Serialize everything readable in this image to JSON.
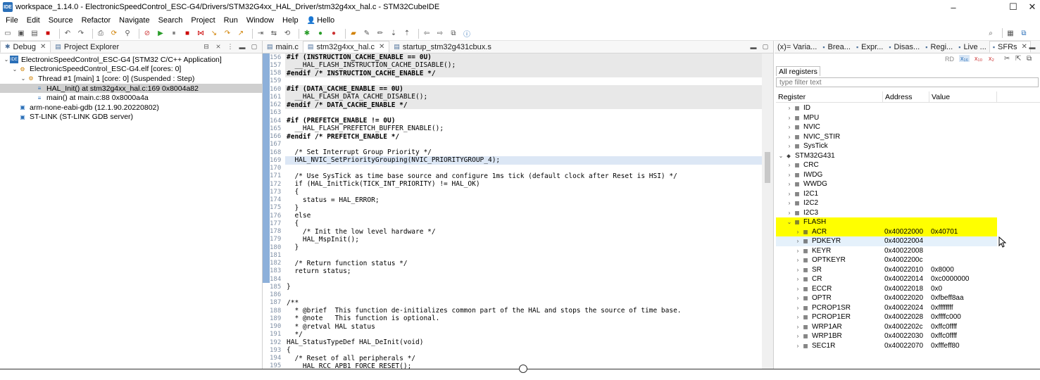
{
  "window": {
    "title": "workspace_1.14.0 - ElectronicSpeedControl_ESC-G4/Drivers/STM32G4xx_HAL_Driver/stm32g4xx_hal.c - STM32CubeIDE",
    "app_icon_label": "IDE"
  },
  "menu": [
    "File",
    "Edit",
    "Source",
    "Refactor",
    "Navigate",
    "Search",
    "Project",
    "Run",
    "Window",
    "Help"
  ],
  "user_label": "Hello",
  "debug_panel": {
    "tabs": [
      {
        "label": "Debug"
      },
      {
        "label": "Project Explorer"
      }
    ],
    "tree": [
      {
        "label": "ElectronicSpeedControl_ESC-G4 [STM32 C/C++ Application]",
        "indent": 0,
        "expanded": true,
        "selected": false
      },
      {
        "label": "ElectronicSpeedControl_ESC-G4.elf [cores: 0]",
        "indent": 1,
        "expanded": true,
        "selected": false
      },
      {
        "label": "Thread #1 [main] 1 [core: 0] (Suspended : Step)",
        "indent": 2,
        "expanded": true,
        "selected": false
      },
      {
        "label": "HAL_Init() at stm32g4xx_hal.c:169 0x8004a82",
        "indent": 3,
        "expanded": null,
        "selected": true
      },
      {
        "label": "main() at main.c:88 0x8000a4a",
        "indent": 3,
        "expanded": null,
        "selected": false
      },
      {
        "label": "arm-none-eabi-gdb (12.1.90.20220802)",
        "indent": 1,
        "expanded": null,
        "selected": false
      },
      {
        "label": "ST-LINK (ST-LINK GDB server)",
        "indent": 1,
        "expanded": null,
        "selected": false
      }
    ]
  },
  "editor": {
    "tabs": [
      {
        "label": "main.c",
        "active": false
      },
      {
        "label": "stm32g4xx_hal.c",
        "active": true
      },
      {
        "label": "startup_stm32g431cbux.s",
        "active": false
      }
    ],
    "lines": [
      {
        "n": "156",
        "text": "#if (INSTRUCTION_CACHE_ENABLE == 0U)",
        "bg": "grey"
      },
      {
        "n": "157",
        "text": "  __HAL_FLASH_INSTRUCTION_CACHE_DISABLE();",
        "bg": "grey"
      },
      {
        "n": "158",
        "text": "#endif /* INSTRUCTION_CACHE_ENABLE */",
        "bg": "grey"
      },
      {
        "n": "159",
        "text": "",
        "bg": ""
      },
      {
        "n": "160",
        "text": "#if (DATA_CACHE_ENABLE == 0U)",
        "bg": "grey"
      },
      {
        "n": "161",
        "text": "  __HAL_FLASH_DATA_CACHE_DISABLE();",
        "bg": "grey"
      },
      {
        "n": "162",
        "text": "#endif /* DATA_CACHE_ENABLE */",
        "bg": "grey"
      },
      {
        "n": "163",
        "text": "",
        "bg": ""
      },
      {
        "n": "164",
        "text": "#if (PREFETCH_ENABLE != 0U)",
        "bg": ""
      },
      {
        "n": "165",
        "text": "  __HAL_FLASH_PREFETCH_BUFFER_ENABLE();",
        "bg": ""
      },
      {
        "n": "166",
        "text": "#endif /* PREFETCH_ENABLE */",
        "bg": ""
      },
      {
        "n": "167",
        "text": "",
        "bg": ""
      },
      {
        "n": "168",
        "text": "  /* Set Interrupt Group Priority */",
        "bg": ""
      },
      {
        "n": "169",
        "text": "  HAL_NVIC_SetPriorityGrouping(NVIC_PRIORITYGROUP_4);",
        "bg": "hl"
      },
      {
        "n": "170",
        "text": "",
        "bg": ""
      },
      {
        "n": "171",
        "text": "  /* Use SysTick as time base source and configure 1ms tick (default clock after Reset is HSI) */",
        "bg": ""
      },
      {
        "n": "172",
        "text": "  if (HAL_InitTick(TICK_INT_PRIORITY) != HAL_OK)",
        "bg": ""
      },
      {
        "n": "173",
        "text": "  {",
        "bg": ""
      },
      {
        "n": "174",
        "text": "    status = HAL_ERROR;",
        "bg": ""
      },
      {
        "n": "175",
        "text": "  }",
        "bg": ""
      },
      {
        "n": "176",
        "text": "  else",
        "bg": ""
      },
      {
        "n": "177",
        "text": "  {",
        "bg": ""
      },
      {
        "n": "178",
        "text": "    /* Init the low level hardware */",
        "bg": ""
      },
      {
        "n": "179",
        "text": "    HAL_MspInit();",
        "bg": ""
      },
      {
        "n": "180",
        "text": "  }",
        "bg": ""
      },
      {
        "n": "181",
        "text": "",
        "bg": ""
      },
      {
        "n": "182",
        "text": "  /* Return function status */",
        "bg": ""
      },
      {
        "n": "183",
        "text": "  return status;",
        "bg": ""
      },
      {
        "n": "184",
        "text": "",
        "bg": ""
      },
      {
        "n": "185",
        "text": "}",
        "bg": ""
      },
      {
        "n": "186",
        "text": "",
        "bg": ""
      },
      {
        "n": "187",
        "text": "/**",
        "bg": ""
      },
      {
        "n": "188",
        "text": "  * @brief  This function de-initializes common part of the HAL and stops the source of time base.",
        "bg": ""
      },
      {
        "n": "189",
        "text": "  * @note   This function is optional.",
        "bg": ""
      },
      {
        "n": "190",
        "text": "  * @retval HAL status",
        "bg": ""
      },
      {
        "n": "191",
        "text": "  */",
        "bg": ""
      },
      {
        "n": "192",
        "text": "HAL_StatusTypeDef HAL_DeInit(void)",
        "bg": ""
      },
      {
        "n": "193",
        "text": "{",
        "bg": ""
      },
      {
        "n": "194",
        "text": "  /* Reset of all peripherals */",
        "bg": ""
      },
      {
        "n": "195",
        "text": "  __HAL_RCC_APB1_FORCE_RESET();",
        "bg": ""
      }
    ]
  },
  "sfr_panel": {
    "tabs": [
      "(x)= Varia...",
      "Brea...",
      "Expr...",
      "Disas...",
      "Regi...",
      "Live ...",
      "SFRs"
    ],
    "rd_label": "RD",
    "all_registers_tab": "All registers",
    "filter_placeholder": "type filter text",
    "columns": [
      "Register",
      "Address",
      "Value"
    ],
    "rows": [
      {
        "name": "ID",
        "indent": 1,
        "exp": ">",
        "address": "",
        "value": "",
        "style": ""
      },
      {
        "name": "MPU",
        "indent": 1,
        "exp": ">",
        "address": "",
        "value": "",
        "style": ""
      },
      {
        "name": "NVIC",
        "indent": 1,
        "exp": ">",
        "address": "",
        "value": "",
        "style": ""
      },
      {
        "name": "NVIC_STIR",
        "indent": 1,
        "exp": ">",
        "address": "",
        "value": "",
        "style": ""
      },
      {
        "name": "SysTick",
        "indent": 1,
        "exp": ">",
        "address": "",
        "value": "",
        "style": ""
      },
      {
        "name": "STM32G431",
        "indent": 0,
        "exp": "v",
        "address": "",
        "value": "",
        "style": ""
      },
      {
        "name": "CRC",
        "indent": 1,
        "exp": ">",
        "address": "",
        "value": "",
        "style": ""
      },
      {
        "name": "IWDG",
        "indent": 1,
        "exp": ">",
        "address": "",
        "value": "",
        "style": ""
      },
      {
        "name": "WWDG",
        "indent": 1,
        "exp": ">",
        "address": "",
        "value": "",
        "style": ""
      },
      {
        "name": "I2C1",
        "indent": 1,
        "exp": ">",
        "address": "",
        "value": "",
        "style": ""
      },
      {
        "name": "I2C2",
        "indent": 1,
        "exp": ">",
        "address": "",
        "value": "",
        "style": ""
      },
      {
        "name": "I2C3",
        "indent": 1,
        "exp": ">",
        "address": "",
        "value": "",
        "style": ""
      },
      {
        "name": "FLASH",
        "indent": 1,
        "exp": "v",
        "address": "",
        "value": "",
        "style": "yellow"
      },
      {
        "name": "ACR",
        "indent": 2,
        "exp": ">",
        "address": "0x40022000",
        "value": "0x40701",
        "style": "yellow"
      },
      {
        "name": "PDKEYR",
        "indent": 2,
        "exp": ">",
        "address": "0x40022004",
        "value": "",
        "style": "hov"
      },
      {
        "name": "KEYR",
        "indent": 2,
        "exp": ">",
        "address": "0x40022008",
        "value": "",
        "style": ""
      },
      {
        "name": "OPTKEYR",
        "indent": 2,
        "exp": ">",
        "address": "0x4002200c",
        "value": "",
        "style": ""
      },
      {
        "name": "SR",
        "indent": 2,
        "exp": ">",
        "address": "0x40022010",
        "value": "0x8000",
        "style": ""
      },
      {
        "name": "CR",
        "indent": 2,
        "exp": ">",
        "address": "0x40022014",
        "value": "0xc0000000",
        "style": ""
      },
      {
        "name": "ECCR",
        "indent": 2,
        "exp": ">",
        "address": "0x40022018",
        "value": "0x0",
        "style": ""
      },
      {
        "name": "OPTR",
        "indent": 2,
        "exp": ">",
        "address": "0x40022020",
        "value": "0xfbeff8aa",
        "style": ""
      },
      {
        "name": "PCROP1SR",
        "indent": 2,
        "exp": ">",
        "address": "0x40022024",
        "value": "0xffffffff",
        "style": ""
      },
      {
        "name": "PCROP1ER",
        "indent": 2,
        "exp": ">",
        "address": "0x40022028",
        "value": "0xffffc000",
        "style": ""
      },
      {
        "name": "WRP1AR",
        "indent": 2,
        "exp": ">",
        "address": "0x4002202c",
        "value": "0xffc0ffff",
        "style": ""
      },
      {
        "name": "WRP1BR",
        "indent": 2,
        "exp": ">",
        "address": "0x40022030",
        "value": "0xffc0ffff",
        "style": ""
      },
      {
        "name": "SEC1R",
        "indent": 2,
        "exp": ">",
        "address": "0x40022070",
        "value": "0xfffeff80",
        "style": ""
      }
    ]
  },
  "colors": {
    "accent": "#2a6fb8",
    "selected_row": "#ffff00",
    "current_line": "#dce7f5"
  }
}
